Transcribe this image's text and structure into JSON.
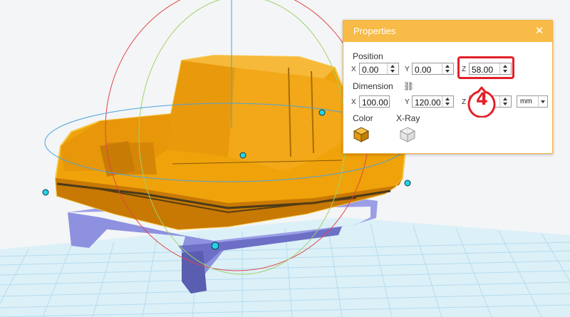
{
  "properties_panel": {
    "title": "Properties",
    "position": {
      "label": "Position",
      "x": {
        "axis": "X",
        "value": "0.00"
      },
      "y": {
        "axis": "Y",
        "value": "0.00"
      },
      "z": {
        "axis": "Z",
        "value": "58.00"
      }
    },
    "dimension": {
      "label": "Dimension",
      "x": {
        "axis": "X",
        "value": "100.00"
      },
      "y": {
        "axis": "Y",
        "value": "120.00"
      },
      "z": {
        "axis": "Z",
        "value": ""
      },
      "unit": "mm"
    },
    "color": {
      "label": "Color",
      "swatch": "#e39b12"
    },
    "xray": {
      "label": "X-Ray"
    }
  },
  "annotation": {
    "step_number": "4",
    "color": "#e22028"
  },
  "viewport": {
    "model_color": "#f0a20a",
    "support_color": "#9b9ee6",
    "grid_color": "#b5dcee",
    "gizmo": {
      "ring_red": "#e04545",
      "ring_green": "#9ed36b",
      "ring_blue": "#4aa3dd",
      "handle_color": "#27d1e6"
    }
  }
}
